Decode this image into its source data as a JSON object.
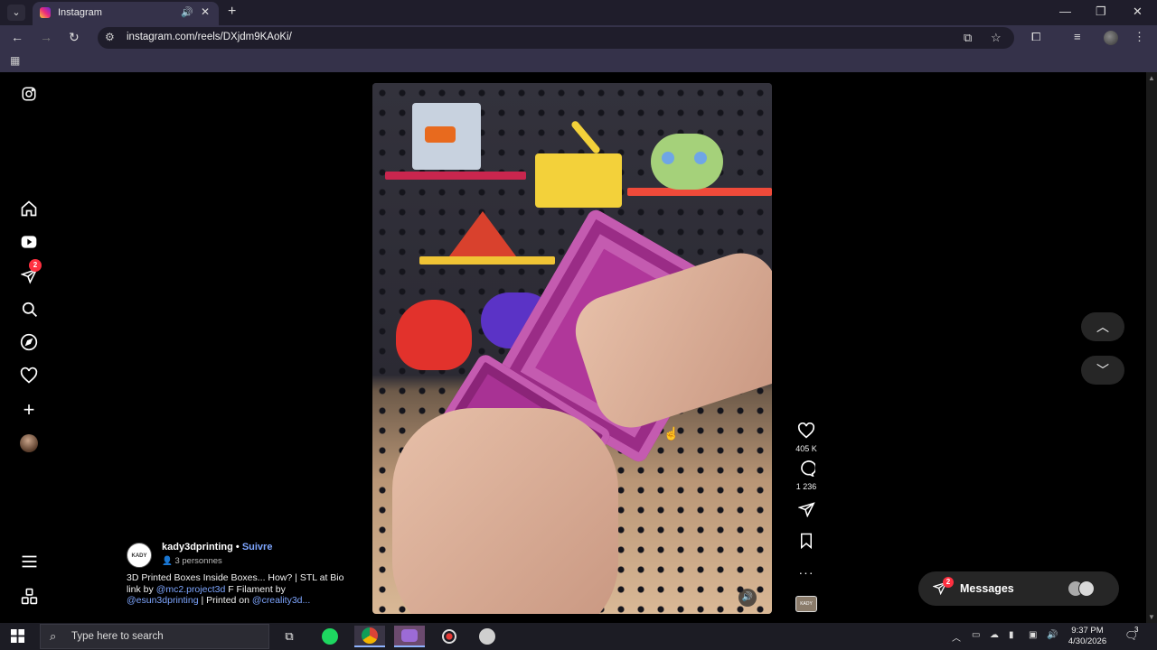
{
  "browser": {
    "tab_title": "Instagram",
    "url": "instagram.com/reels/DXjdm9KAoKi/"
  },
  "sidebar": {
    "items": [
      {
        "icon": "instagram-logo-icon"
      },
      {
        "icon": "home-icon"
      },
      {
        "icon": "reels-icon"
      },
      {
        "icon": "direct-messages-icon",
        "badge": "2"
      },
      {
        "icon": "search-icon"
      },
      {
        "icon": "explore-icon"
      },
      {
        "icon": "notifications-heart-icon"
      },
      {
        "icon": "create-icon"
      },
      {
        "icon": "profile-avatar"
      },
      {
        "icon": "menu-icon"
      },
      {
        "icon": "also-from-meta-icon"
      }
    ]
  },
  "reel": {
    "likes": "405 K",
    "comments": "1 236",
    "thumb_label": "KADY"
  },
  "author": {
    "avatar_label": "KADY",
    "username": "kady3dprinting",
    "separator": " • ",
    "follow_label": "Suivre",
    "followers": "3 personnes",
    "caption_part1": "3D Printed Boxes Inside Boxes... How? | STL at Bio link by ",
    "mention1": "@mc2.project3d",
    "caption_part2": " F Filament by ",
    "mention2": "@esun3dprinting",
    "caption_part3": " | Printed on ",
    "mention3": "@creality3d..."
  },
  "messages": {
    "label": "Messages",
    "badge": "2"
  },
  "taskbar": {
    "search_placeholder": "Type here to search",
    "time": "9:37 PM",
    "date": "4/30/2026",
    "notification_count": "3"
  },
  "colors": {
    "link": "#7ea6ff",
    "badge": "#ff3040",
    "box_purple": "#b0379a"
  }
}
